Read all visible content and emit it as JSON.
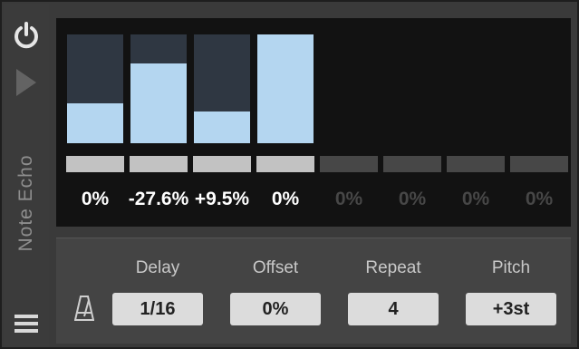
{
  "device": {
    "title": "Note Echo"
  },
  "icons": {
    "power": "power-icon",
    "play": "play-icon",
    "menu": "menu-icon",
    "metronome": "metronome-icon"
  },
  "colors": {
    "bar_fill": "#b4d6f0",
    "bar_empty": "#2f3742",
    "toggle_active": "#c2c2c2",
    "toggle_inactive": "#474747",
    "value_active": "#ffffff",
    "value_inactive": "#474747"
  },
  "steps": [
    {
      "value_text": "0%",
      "fill_fraction": 0.37,
      "active": true
    },
    {
      "value_text": "-27.6%",
      "fill_fraction": 0.73,
      "active": true
    },
    {
      "value_text": "+9.5%",
      "fill_fraction": 0.29,
      "active": true
    },
    {
      "value_text": "0%",
      "fill_fraction": 1.0,
      "active": true
    },
    {
      "value_text": "0%",
      "fill_fraction": 0,
      "active": false
    },
    {
      "value_text": "0%",
      "fill_fraction": 0,
      "active": false
    },
    {
      "value_text": "0%",
      "fill_fraction": 0,
      "active": false
    },
    {
      "value_text": "0%",
      "fill_fraction": 0,
      "active": false
    }
  ],
  "params": {
    "delay": {
      "label": "Delay",
      "value": "1/16"
    },
    "offset": {
      "label": "Offset",
      "value": "0%"
    },
    "repeat": {
      "label": "Repeat",
      "value": "4"
    },
    "pitch": {
      "label": "Pitch",
      "value": "+3st"
    }
  }
}
